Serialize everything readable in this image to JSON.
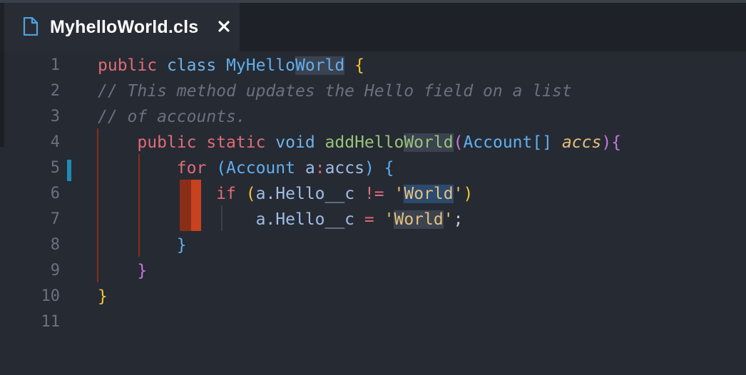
{
  "tab": {
    "title": "MyhelloWorld.cls",
    "icon": "file-icon",
    "close_icon": "close-icon"
  },
  "editor": {
    "line_numbers": [
      "1",
      "2",
      "3",
      "4",
      "5",
      "6",
      "7",
      "8",
      "9",
      "10",
      "11"
    ],
    "lines": [
      {
        "parts": [
          [
            "public",
            "kw"
          ],
          [
            " ",
            ""
          ],
          [
            "class",
            "kw2"
          ],
          [
            " ",
            ""
          ],
          [
            "MyHello",
            "type"
          ],
          [
            "World",
            "type hlw"
          ],
          [
            " ",
            ""
          ],
          [
            "{",
            "brace-y"
          ]
        ]
      },
      {
        "parts": [
          [
            "// This method updates the Hello field on a list",
            "comment"
          ]
        ]
      },
      {
        "parts": [
          [
            "// of accounts.",
            "comment"
          ]
        ]
      },
      {
        "parts": [
          [
            "    ",
            ""
          ],
          [
            "public",
            "kw"
          ],
          [
            " ",
            ""
          ],
          [
            "static",
            "kw"
          ],
          [
            " ",
            ""
          ],
          [
            "void",
            "kw2"
          ],
          [
            " ",
            ""
          ],
          [
            "addHello",
            "fn"
          ],
          [
            "World",
            "fn hlw"
          ],
          [
            "(",
            "brace-paren"
          ],
          [
            "Account",
            "type"
          ],
          [
            "[]",
            "type"
          ],
          [
            " ",
            ""
          ],
          [
            "accs",
            "param"
          ],
          [
            ")",
            "brace-paren"
          ],
          [
            "{",
            "brace-m"
          ]
        ]
      },
      {
        "parts": [
          [
            "        ",
            ""
          ],
          [
            "for",
            "kw"
          ],
          [
            " ",
            ""
          ],
          [
            "(",
            "brace-b"
          ],
          [
            "Account",
            "type"
          ],
          [
            " ",
            ""
          ],
          [
            "a",
            "plain"
          ],
          [
            ":",
            "op"
          ],
          [
            "accs",
            "plain"
          ],
          [
            ")",
            "brace-b"
          ],
          [
            " ",
            ""
          ],
          [
            "{",
            "brace-b"
          ]
        ]
      },
      {
        "parts": [
          [
            "            ",
            ""
          ],
          [
            "if",
            "kw"
          ],
          [
            " ",
            ""
          ],
          [
            "(",
            "brace-y"
          ],
          [
            "a.Hello__c",
            "plain"
          ],
          [
            " ",
            ""
          ],
          [
            "!=",
            "op"
          ],
          [
            " ",
            ""
          ],
          [
            "'",
            "str"
          ],
          [
            "World",
            "str hls"
          ],
          [
            "'",
            "str"
          ],
          [
            ")",
            "brace-y"
          ]
        ]
      },
      {
        "parts": [
          [
            "                ",
            ""
          ],
          [
            "a.Hello__c",
            "plain"
          ],
          [
            " ",
            ""
          ],
          [
            "=",
            "op"
          ],
          [
            " ",
            ""
          ],
          [
            "'",
            "str"
          ],
          [
            "World",
            "str hlw"
          ],
          [
            "'",
            "str"
          ],
          [
            ";",
            ""
          ]
        ]
      },
      {
        "parts": [
          [
            "        ",
            ""
          ],
          [
            "}",
            "brace-b"
          ]
        ]
      },
      {
        "parts": [
          [
            "    ",
            ""
          ],
          [
            "}",
            "brace-m"
          ]
        ]
      },
      {
        "parts": [
          [
            "}",
            "brace-y"
          ]
        ]
      },
      {
        "parts": []
      }
    ]
  },
  "colors": {
    "background": "#262a33",
    "modified_marker": "#1e8bb4",
    "error_dark": "#8b2e17",
    "error_light": "#c9421f"
  }
}
